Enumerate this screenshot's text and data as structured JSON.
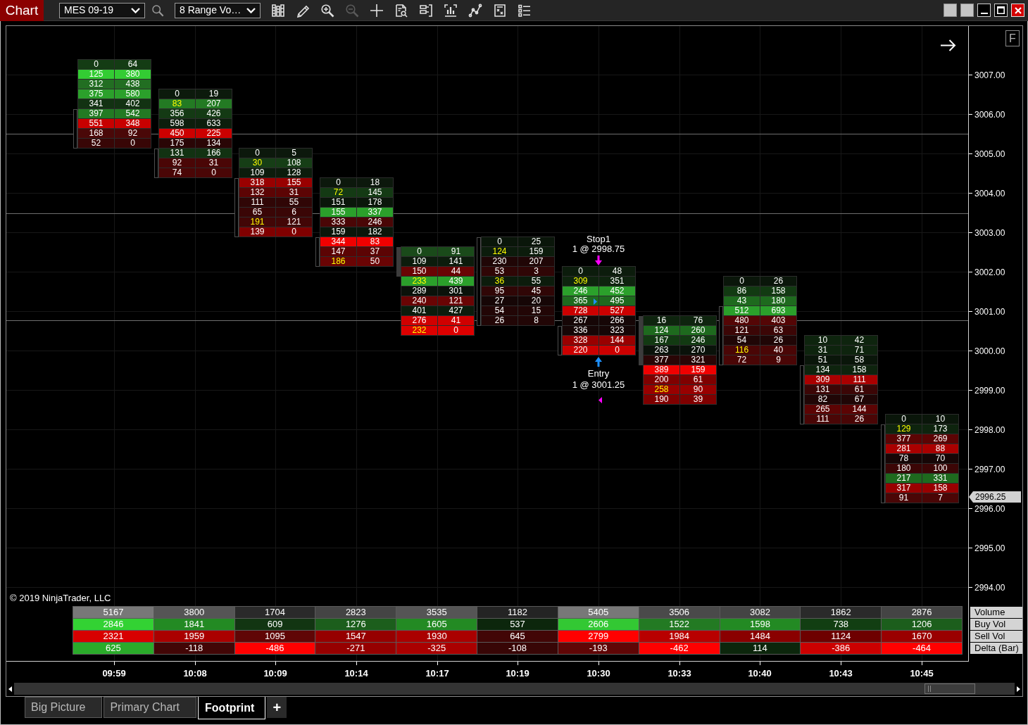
{
  "header": {
    "title": "Chart",
    "instrument": "MES 09-19",
    "interval": "8 Range Vo…"
  },
  "toolbar_buttons": [
    {
      "disabled": false
    },
    {
      "disabled": false
    },
    {
      "disabled": false
    },
    {
      "disabled": true
    },
    {
      "disabled": false
    },
    {
      "disabled": false
    },
    {
      "disabled": false
    },
    {
      "disabled": false
    },
    {
      "disabled": false
    },
    {
      "disabled": false
    },
    {
      "disabled": false
    }
  ],
  "bars": [
    {
      "body_filled": false,
      "rows": [
        {
          "bid": "0",
          "ask": "64",
          "color": "#143c14",
          "highlight": false
        },
        {
          "bid": "125",
          "ask": "380",
          "color": "#33cc33",
          "highlight": false
        },
        {
          "bid": "312",
          "ask": "438",
          "color": "#226e22",
          "highlight": false
        },
        {
          "bid": "375",
          "ask": "580",
          "color": "#2ba02b",
          "highlight": false
        },
        {
          "bid": "341",
          "ask": "402",
          "color": "#123212",
          "highlight": false
        },
        {
          "bid": "397",
          "ask": "542",
          "color": "#237a23",
          "highlight": false
        },
        {
          "bid": "551",
          "ask": "348",
          "color": "#c80000",
          "highlight": false
        },
        {
          "bid": "168",
          "ask": "92",
          "color": "#4a0808",
          "highlight": false
        },
        {
          "bid": "52",
          "ask": "0",
          "color": "#380606",
          "highlight": false
        }
      ]
    },
    {
      "body_filled": false,
      "rows": [
        {
          "bid": "0",
          "ask": "19",
          "color": "#0c1a0c",
          "highlight": false
        },
        {
          "bid": "83",
          "ask": "207",
          "color": "#237a23",
          "highlight": true
        },
        {
          "bid": "356",
          "ask": "426",
          "color": "#143a14",
          "highlight": false
        },
        {
          "bid": "598",
          "ask": "633",
          "color": "#0c1e0c",
          "highlight": false
        },
        {
          "bid": "450",
          "ask": "225",
          "color": "#cc0000",
          "highlight": false
        },
        {
          "bid": "175",
          "ask": "134",
          "color": "#2a0606",
          "highlight": false
        },
        {
          "bid": "131",
          "ask": "166",
          "color": "#123212",
          "highlight": false
        },
        {
          "bid": "92",
          "ask": "31",
          "color": "#4a0606",
          "highlight": false
        },
        {
          "bid": "74",
          "ask": "0",
          "color": "#4a0606",
          "highlight": false
        }
      ]
    },
    {
      "body_filled": false,
      "rows": [
        {
          "bid": "0",
          "ask": "5",
          "color": "#0c180c",
          "highlight": false
        },
        {
          "bid": "30",
          "ask": "108",
          "color": "#163e16",
          "highlight": true
        },
        {
          "bid": "109",
          "ask": "128",
          "color": "#0c1c0c",
          "highlight": false
        },
        {
          "bid": "318",
          "ask": "155",
          "color": "#990000",
          "highlight": false
        },
        {
          "bid": "132",
          "ask": "31",
          "color": "#5c0404",
          "highlight": false
        },
        {
          "bid": "111",
          "ask": "55",
          "color": "#300606",
          "highlight": false
        },
        {
          "bid": "65",
          "ask": "6",
          "color": "#3a0606",
          "highlight": false
        },
        {
          "bid": "191",
          "ask": "121",
          "color": "#420606",
          "highlight": true
        },
        {
          "bid": "139",
          "ask": "0",
          "color": "#800000",
          "highlight": false
        }
      ]
    },
    {
      "body_filled": false,
      "rows": [
        {
          "bid": "0",
          "ask": "18",
          "color": "#0c180c",
          "highlight": false
        },
        {
          "bid": "72",
          "ask": "145",
          "color": "#143a14",
          "highlight": true
        },
        {
          "bid": "151",
          "ask": "178",
          "color": "#0a160a",
          "highlight": false
        },
        {
          "bid": "155",
          "ask": "337",
          "color": "#2ba02b",
          "highlight": false
        },
        {
          "bid": "333",
          "ask": "246",
          "color": "#4a0606",
          "highlight": false
        },
        {
          "bid": "159",
          "ask": "182",
          "color": "#0a160a",
          "highlight": false
        },
        {
          "bid": "344",
          "ask": "83",
          "color": "#f00000",
          "highlight": false
        },
        {
          "bid": "147",
          "ask": "37",
          "color": "#5c0404",
          "highlight": false
        },
        {
          "bid": "186",
          "ask": "50",
          "color": "#6a0404",
          "highlight": true
        }
      ]
    },
    {
      "body_filled": true,
      "rows": [
        {
          "bid": "0",
          "ask": "91",
          "color": "#1a4a1a",
          "highlight": false
        },
        {
          "bid": "109",
          "ask": "141",
          "color": "#0c1c0c",
          "highlight": false
        },
        {
          "bid": "150",
          "ask": "44",
          "color": "#6a0404",
          "highlight": false
        },
        {
          "bid": "233",
          "ask": "439",
          "color": "#2ba02b",
          "highlight": true
        },
        {
          "bid": "289",
          "ask": "301",
          "color": "#0a120a",
          "highlight": false
        },
        {
          "bid": "240",
          "ask": "121",
          "color": "#6a0404",
          "highlight": false
        },
        {
          "bid": "401",
          "ask": "427",
          "color": "#0c1c0c",
          "highlight": false
        },
        {
          "bid": "276",
          "ask": "41",
          "color": "#d00000",
          "highlight": false
        },
        {
          "bid": "232",
          "ask": "0",
          "color": "#dd0000",
          "highlight": true
        }
      ]
    },
    {
      "body_filled": false,
      "rows": [
        {
          "bid": "0",
          "ask": "25",
          "color": "#0a160a",
          "highlight": false
        },
        {
          "bid": "124",
          "ask": "159",
          "color": "#0c1c0c",
          "highlight": true
        },
        {
          "bid": "230",
          "ask": "207",
          "color": "#200606",
          "highlight": false
        },
        {
          "bid": "53",
          "ask": "3",
          "color": "#300606",
          "highlight": false
        },
        {
          "bid": "36",
          "ask": "55",
          "color": "#0c1c0c",
          "highlight": true
        },
        {
          "bid": "95",
          "ask": "45",
          "color": "#300606",
          "highlight": false
        },
        {
          "bid": "27",
          "ask": "20",
          "color": "#160606",
          "highlight": false
        },
        {
          "bid": "54",
          "ask": "15",
          "color": "#220606",
          "highlight": false
        },
        {
          "bid": "26",
          "ask": "8",
          "color": "#220606",
          "highlight": false
        }
      ]
    },
    {
      "body_filled": false,
      "rows": [
        {
          "bid": "0",
          "ask": "48",
          "color": "#0c1c0c",
          "highlight": false
        },
        {
          "bid": "309",
          "ask": "351",
          "color": "#0e240e",
          "highlight": true
        },
        {
          "bid": "246",
          "ask": "452",
          "color": "#2ba02b",
          "highlight": false
        },
        {
          "bid": "365",
          "ask": "495",
          "color": "#1e6a1e",
          "highlight": false
        },
        {
          "bid": "728",
          "ask": "527",
          "color": "#cc0000",
          "highlight": false
        },
        {
          "bid": "267",
          "ask": "266",
          "color": "#160606",
          "highlight": false
        },
        {
          "bid": "336",
          "ask": "323",
          "color": "#160606",
          "highlight": false
        },
        {
          "bid": "328",
          "ask": "144",
          "color": "#990000",
          "highlight": false
        },
        {
          "bid": "220",
          "ask": "0",
          "color": "#cc0000",
          "highlight": false
        }
      ]
    },
    {
      "body_filled": true,
      "rows": [
        {
          "bid": "16",
          "ask": "76",
          "color": "#0e240e",
          "highlight": false
        },
        {
          "bid": "124",
          "ask": "260",
          "color": "#1e6a1e",
          "highlight": false
        },
        {
          "bid": "167",
          "ask": "246",
          "color": "#123a12",
          "highlight": false
        },
        {
          "bid": "263",
          "ask": "270",
          "color": "#0a120a",
          "highlight": false
        },
        {
          "bid": "377",
          "ask": "321",
          "color": "#2a0606",
          "highlight": false
        },
        {
          "bid": "389",
          "ask": "159",
          "color": "#f00000",
          "highlight": false
        },
        {
          "bid": "200",
          "ask": "61",
          "color": "#800000",
          "highlight": false
        },
        {
          "bid": "258",
          "ask": "90",
          "color": "#990000",
          "highlight": true
        },
        {
          "bid": "190",
          "ask": "39",
          "color": "#800000",
          "highlight": false
        }
      ]
    },
    {
      "body_filled": false,
      "rows": [
        {
          "bid": "0",
          "ask": "26",
          "color": "#0a160a",
          "highlight": false
        },
        {
          "bid": "86",
          "ask": "158",
          "color": "#123a12",
          "highlight": false
        },
        {
          "bid": "43",
          "ask": "180",
          "color": "#1e6a1e",
          "highlight": false
        },
        {
          "bid": "512",
          "ask": "693",
          "color": "#2ba02b",
          "highlight": false
        },
        {
          "bid": "480",
          "ask": "403",
          "color": "#550606",
          "highlight": false
        },
        {
          "bid": "121",
          "ask": "63",
          "color": "#3c0606",
          "highlight": false
        },
        {
          "bid": "54",
          "ask": "26",
          "color": "#200606",
          "highlight": false
        },
        {
          "bid": "116",
          "ask": "40",
          "color": "#4a0606",
          "highlight": true
        },
        {
          "bid": "72",
          "ask": "9",
          "color": "#4a0606",
          "highlight": false
        }
      ]
    },
    {
      "body_filled": false,
      "rows": [
        {
          "bid": "10",
          "ask": "42",
          "color": "#0e240e",
          "highlight": false
        },
        {
          "bid": "31",
          "ask": "71",
          "color": "#0e240e",
          "highlight": false
        },
        {
          "bid": "51",
          "ask": "58",
          "color": "#0a160a",
          "highlight": false
        },
        {
          "bid": "134",
          "ask": "158",
          "color": "#0e240e",
          "highlight": false
        },
        {
          "bid": "309",
          "ask": "111",
          "color": "#aa0000",
          "highlight": false
        },
        {
          "bid": "131",
          "ask": "61",
          "color": "#3c0606",
          "highlight": false
        },
        {
          "bid": "82",
          "ask": "67",
          "color": "#200606",
          "highlight": false
        },
        {
          "bid": "265",
          "ask": "144",
          "color": "#5c0404",
          "highlight": false
        },
        {
          "bid": "111",
          "ask": "26",
          "color": "#4a0606",
          "highlight": false
        }
      ]
    },
    {
      "body_filled": false,
      "rows": [
        {
          "bid": "0",
          "ask": "10",
          "color": "#0a160a",
          "highlight": false
        },
        {
          "bid": "129",
          "ask": "173",
          "color": "#0e240e",
          "highlight": true
        },
        {
          "bid": "377",
          "ask": "269",
          "color": "#5c0404",
          "highlight": false
        },
        {
          "bid": "281",
          "ask": "88",
          "color": "#aa0000",
          "highlight": false
        },
        {
          "bid": "78",
          "ask": "70",
          "color": "#160606",
          "highlight": false
        },
        {
          "bid": "180",
          "ask": "100",
          "color": "#3c0606",
          "highlight": false
        },
        {
          "bid": "217",
          "ask": "331",
          "color": "#1e6a1e",
          "highlight": false
        },
        {
          "bid": "317",
          "ask": "158",
          "color": "#990000",
          "highlight": false
        },
        {
          "bid": "91",
          "ask": "7",
          "color": "#4a0606",
          "highlight": false
        }
      ]
    }
  ],
  "orders": [
    {
      "kind": "stop",
      "name": "Stop1",
      "detail": "1 @ 2998.75"
    },
    {
      "kind": "entry",
      "name": "Entry",
      "detail": "1 @ 3001.25"
    }
  ],
  "summary": {
    "labels": [
      "Volume",
      "Buy Vol",
      "Sell Vol",
      "Delta (Bar)"
    ],
    "rows": [
      {
        "cells": [
          {
            "value": "5167",
            "color": "#787878"
          },
          {
            "value": "3800",
            "color": "#555555"
          },
          {
            "value": "1704",
            "color": "#2a2a2a"
          },
          {
            "value": "2823",
            "color": "#444444"
          },
          {
            "value": "3535",
            "color": "#555555"
          },
          {
            "value": "1182",
            "color": "#242424"
          },
          {
            "value": "5405",
            "color": "#787878"
          },
          {
            "value": "3506",
            "color": "#4a4a4a"
          },
          {
            "value": "3082",
            "color": "#444444"
          },
          {
            "value": "1862",
            "color": "#2a2a2a"
          },
          {
            "value": "2876",
            "color": "#444444"
          }
        ]
      },
      {
        "cells": [
          {
            "value": "2846",
            "color": "#33d233"
          },
          {
            "value": "1841",
            "color": "#238a23"
          },
          {
            "value": "609",
            "color": "#123512"
          },
          {
            "value": "1276",
            "color": "#1c5e1c"
          },
          {
            "value": "1605",
            "color": "#238a23"
          },
          {
            "value": "537",
            "color": "#0c260c"
          },
          {
            "value": "2606",
            "color": "#33c833"
          },
          {
            "value": "1522",
            "color": "#237a23"
          },
          {
            "value": "1598",
            "color": "#238a23"
          },
          {
            "value": "738",
            "color": "#123e12"
          },
          {
            "value": "1206",
            "color": "#1c5e1c"
          }
        ]
      },
      {
        "cells": [
          {
            "value": "2321",
            "color": "#d80000"
          },
          {
            "value": "1959",
            "color": "#aa0000"
          },
          {
            "value": "1095",
            "color": "#600606"
          },
          {
            "value": "1547",
            "color": "#960000"
          },
          {
            "value": "1930",
            "color": "#aa0000"
          },
          {
            "value": "645",
            "color": "#420606"
          },
          {
            "value": "2799",
            "color": "#ff0000"
          },
          {
            "value": "1984",
            "color": "#b80000"
          },
          {
            "value": "1484",
            "color": "#8a0000"
          },
          {
            "value": "1124",
            "color": "#6e0000"
          },
          {
            "value": "1670",
            "color": "#9a0000"
          }
        ]
      },
      {
        "cells": [
          {
            "value": "625",
            "color": "#2aaa2a"
          },
          {
            "value": "-118",
            "color": "#420606"
          },
          {
            "value": "-486",
            "color": "#ff0000"
          },
          {
            "value": "-271",
            "color": "#960000"
          },
          {
            "value": "-325",
            "color": "#aa0000"
          },
          {
            "value": "-108",
            "color": "#380606"
          },
          {
            "value": "-193",
            "color": "#600606"
          },
          {
            "value": "-462",
            "color": "#ff0000"
          },
          {
            "value": "114",
            "color": "#0c260c"
          },
          {
            "value": "-386",
            "color": "#cc0000"
          },
          {
            "value": "-464",
            "color": "#ff0000"
          }
        ]
      }
    ]
  },
  "copyright": "© 2019 NinjaTrader, LLC",
  "price_axis": {
    "button": "F",
    "labels": [
      "3007.00",
      "3006.00",
      "3005.00",
      "3004.00",
      "3003.00",
      "3002.00",
      "3001.00",
      "3000.00",
      "2999.00",
      "2998.00",
      "2997.00",
      "2996.00",
      "2995.00",
      "2994.00"
    ],
    "current_price": "2996.25"
  },
  "time_axis": [
    "09:59",
    "10:08",
    "10:09",
    "10:14",
    "10:17",
    "10:19",
    "10:30",
    "10:33",
    "10:40",
    "10:43",
    "10:45"
  ],
  "tabs": [
    {
      "label": "Big Picture",
      "selected": false
    },
    {
      "label": "Primary Chart",
      "selected": false
    },
    {
      "label": "Footprint",
      "selected": true
    }
  ],
  "add_tab": "+"
}
